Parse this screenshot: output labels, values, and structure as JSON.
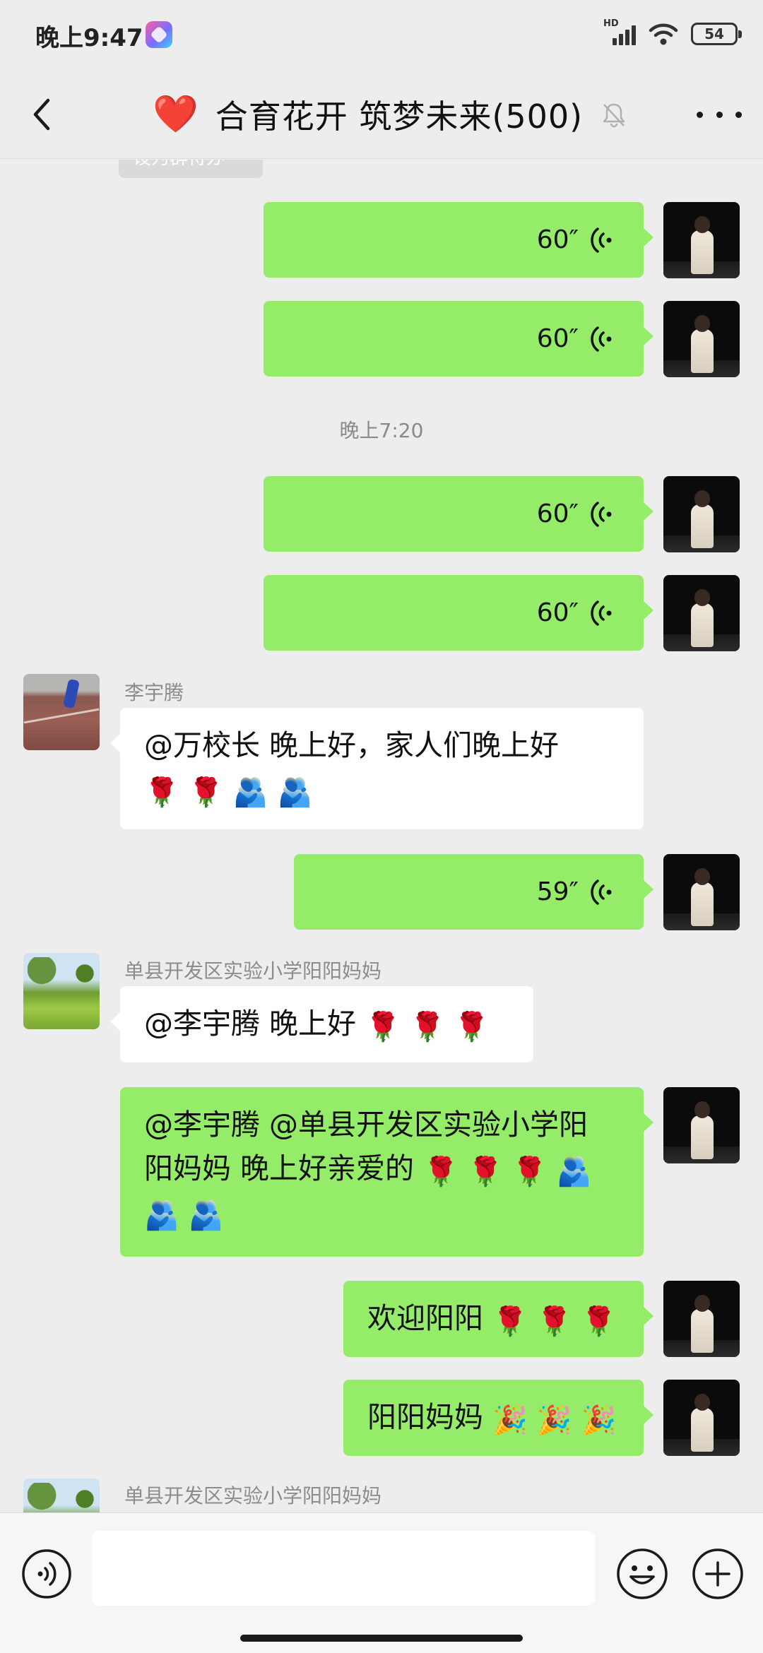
{
  "status_bar": {
    "time": "晚上9:47",
    "network": "HD",
    "battery": "54"
  },
  "header": {
    "title": "合育花开 筑梦未来(500)",
    "heart_emoji": "❤️"
  },
  "chat": {
    "system_tag": "设为群待办",
    "timestamp": "晚上7:20",
    "voice_durations": [
      "60″",
      "60″",
      "60″",
      "60″",
      "59″"
    ],
    "sender_liyuteng": "李宇腾",
    "msg_liyuteng_text": "@万校长  晚上好，家人们晚上好",
    "sender_yangyang": "单县开发区实验小学阳阳妈妈",
    "msg_yangyang_text": "@李宇腾  晚上好",
    "msg_self_reply_line1": "@李宇腾 @单县开发区实验小学阳",
    "msg_self_reply_line2": "阳妈妈  晚上好亲爱的",
    "msg_welcome_text": "欢迎阳阳",
    "msg_yangyang_mom_text": "阳阳妈妈",
    "sender_yangyang_bottom": "单县开发区实验小学阳阳妈妈"
  },
  "emoji": {
    "rose": "🌹",
    "hug": "🫂",
    "party": "🎉"
  },
  "colors": {
    "background": "#ededed",
    "bubble_self": "#95ec69",
    "bubble_other": "#ffffff",
    "input_bar": "#f6f6f6"
  },
  "icons": [
    "back-arrow-icon",
    "mute-icon",
    "more-icon",
    "voice-wave-icon",
    "voice-mode-icon",
    "emoji-icon",
    "plus-icon"
  ]
}
